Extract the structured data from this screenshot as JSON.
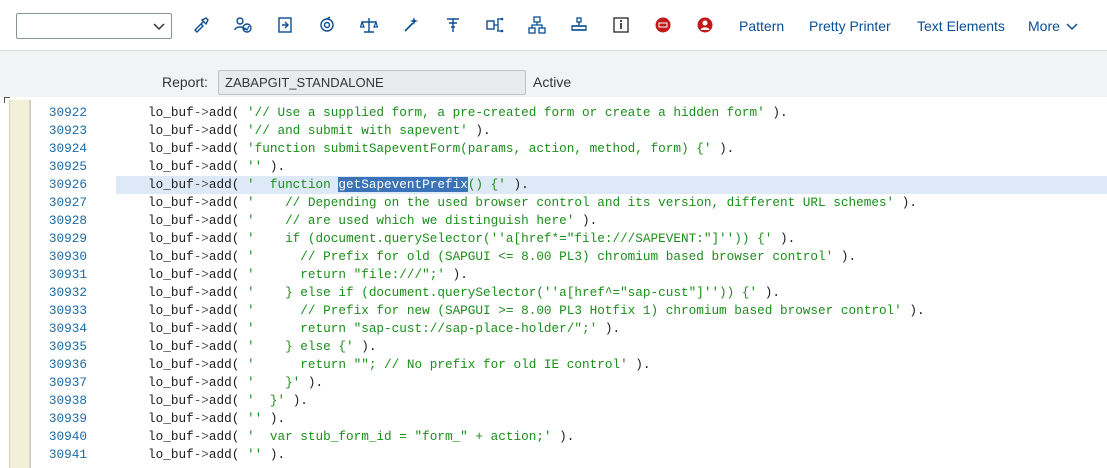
{
  "toolbar": {
    "select_value": "",
    "icons": [
      {
        "name": "check-syntax-icon"
      },
      {
        "name": "activate-icon"
      },
      {
        "name": "test-icon"
      },
      {
        "name": "where-used-icon"
      },
      {
        "name": "object-list-icon"
      },
      {
        "name": "display-object-icon"
      },
      {
        "name": "breakpoint-icon"
      },
      {
        "name": "navigation-icon"
      },
      {
        "name": "hierarchy-icon"
      },
      {
        "name": "enhance-icon"
      },
      {
        "name": "info-icon"
      },
      {
        "name": "stop-icon"
      },
      {
        "name": "user-icon"
      }
    ],
    "pattern_label": "Pattern",
    "pretty_printer_label": "Pretty Printer",
    "text_elements_label": "Text Elements",
    "more_label": "More",
    "accent_color": "#0a4d92"
  },
  "report": {
    "label": "Report:",
    "name": "ZABAPGIT_STANDALONE",
    "status": "Active"
  },
  "editor": {
    "current_line": "30926",
    "selected_text": "getSapeventPrefix",
    "lines": [
      {
        "num": "30922",
        "obj": "lo_buf",
        "arrow": "->",
        "method": "add( ",
        "str": "'// Use a supplied form, a pre-created form or create a hidden form'",
        "tail": " )."
      },
      {
        "num": "30923",
        "obj": "lo_buf",
        "arrow": "->",
        "method": "add( ",
        "str": "'// and submit with sapevent'",
        "tail": " )."
      },
      {
        "num": "30924",
        "obj": "lo_buf",
        "arrow": "->",
        "method": "add( ",
        "str": "'function submitSapeventForm(params, action, method, form) {'",
        "tail": " )."
      },
      {
        "num": "30925",
        "obj": "lo_buf",
        "arrow": "->",
        "method": "add( ",
        "str": "''",
        "tail": " )."
      },
      {
        "num": "30926",
        "obj": "lo_buf",
        "arrow": "->",
        "method": "add( ",
        "str_pre": "'  function ",
        "str_sel": "getSapeventPrefix",
        "str_post": "() {'",
        "tail": " )."
      },
      {
        "num": "30927",
        "obj": "lo_buf",
        "arrow": "->",
        "method": "add( ",
        "str": "'    // Depending on the used browser control and its version, different URL schemes'",
        "tail": " )."
      },
      {
        "num": "30928",
        "obj": "lo_buf",
        "arrow": "->",
        "method": "add( ",
        "str": "'    // are used which we distinguish here'",
        "tail": " )."
      },
      {
        "num": "30929",
        "obj": "lo_buf",
        "arrow": "->",
        "method": "add( ",
        "str": "'    if (document.querySelector(''a[href*=\"file:///SAPEVENT:\"]'')) {'",
        "tail": " )."
      },
      {
        "num": "30930",
        "obj": "lo_buf",
        "arrow": "->",
        "method": "add( ",
        "str": "'      // Prefix for old (SAPGUI <= 8.00 PL3) chromium based browser control'",
        "tail": " )."
      },
      {
        "num": "30931",
        "obj": "lo_buf",
        "arrow": "->",
        "method": "add( ",
        "str": "'      return \"file:///\";'",
        "tail": " )."
      },
      {
        "num": "30932",
        "obj": "lo_buf",
        "arrow": "->",
        "method": "add( ",
        "str": "'    } else if (document.querySelector(''a[href^=\"sap-cust\"]'')) {'",
        "tail": " )."
      },
      {
        "num": "30933",
        "obj": "lo_buf",
        "arrow": "->",
        "method": "add( ",
        "str": "'      // Prefix for new (SAPGUI >= 8.00 PL3 Hotfix 1) chromium based browser control'",
        "tail": " )."
      },
      {
        "num": "30934",
        "obj": "lo_buf",
        "arrow": "->",
        "method": "add( ",
        "str": "'      return \"sap-cust://sap-place-holder/\";'",
        "tail": " )."
      },
      {
        "num": "30935",
        "obj": "lo_buf",
        "arrow": "->",
        "method": "add( ",
        "str": "'    } else {'",
        "tail": " )."
      },
      {
        "num": "30936",
        "obj": "lo_buf",
        "arrow": "->",
        "method": "add( ",
        "str": "'      return \"\"; // No prefix for old IE control'",
        "tail": " )."
      },
      {
        "num": "30937",
        "obj": "lo_buf",
        "arrow": "->",
        "method": "add( ",
        "str": "'    }'",
        "tail": " )."
      },
      {
        "num": "30938",
        "obj": "lo_buf",
        "arrow": "->",
        "method": "add( ",
        "str": "'  }'",
        "tail": " )."
      },
      {
        "num": "30939",
        "obj": "lo_buf",
        "arrow": "->",
        "method": "add( ",
        "str": "''",
        "tail": " )."
      },
      {
        "num": "30940",
        "obj": "lo_buf",
        "arrow": "->",
        "method": "add( ",
        "str": "'  var stub_form_id = \"form_\" + action;'",
        "tail": " )."
      },
      {
        "num": "30941",
        "obj": "lo_buf",
        "arrow": "->",
        "method": "add( ",
        "str": "''",
        "tail": " )."
      }
    ]
  }
}
